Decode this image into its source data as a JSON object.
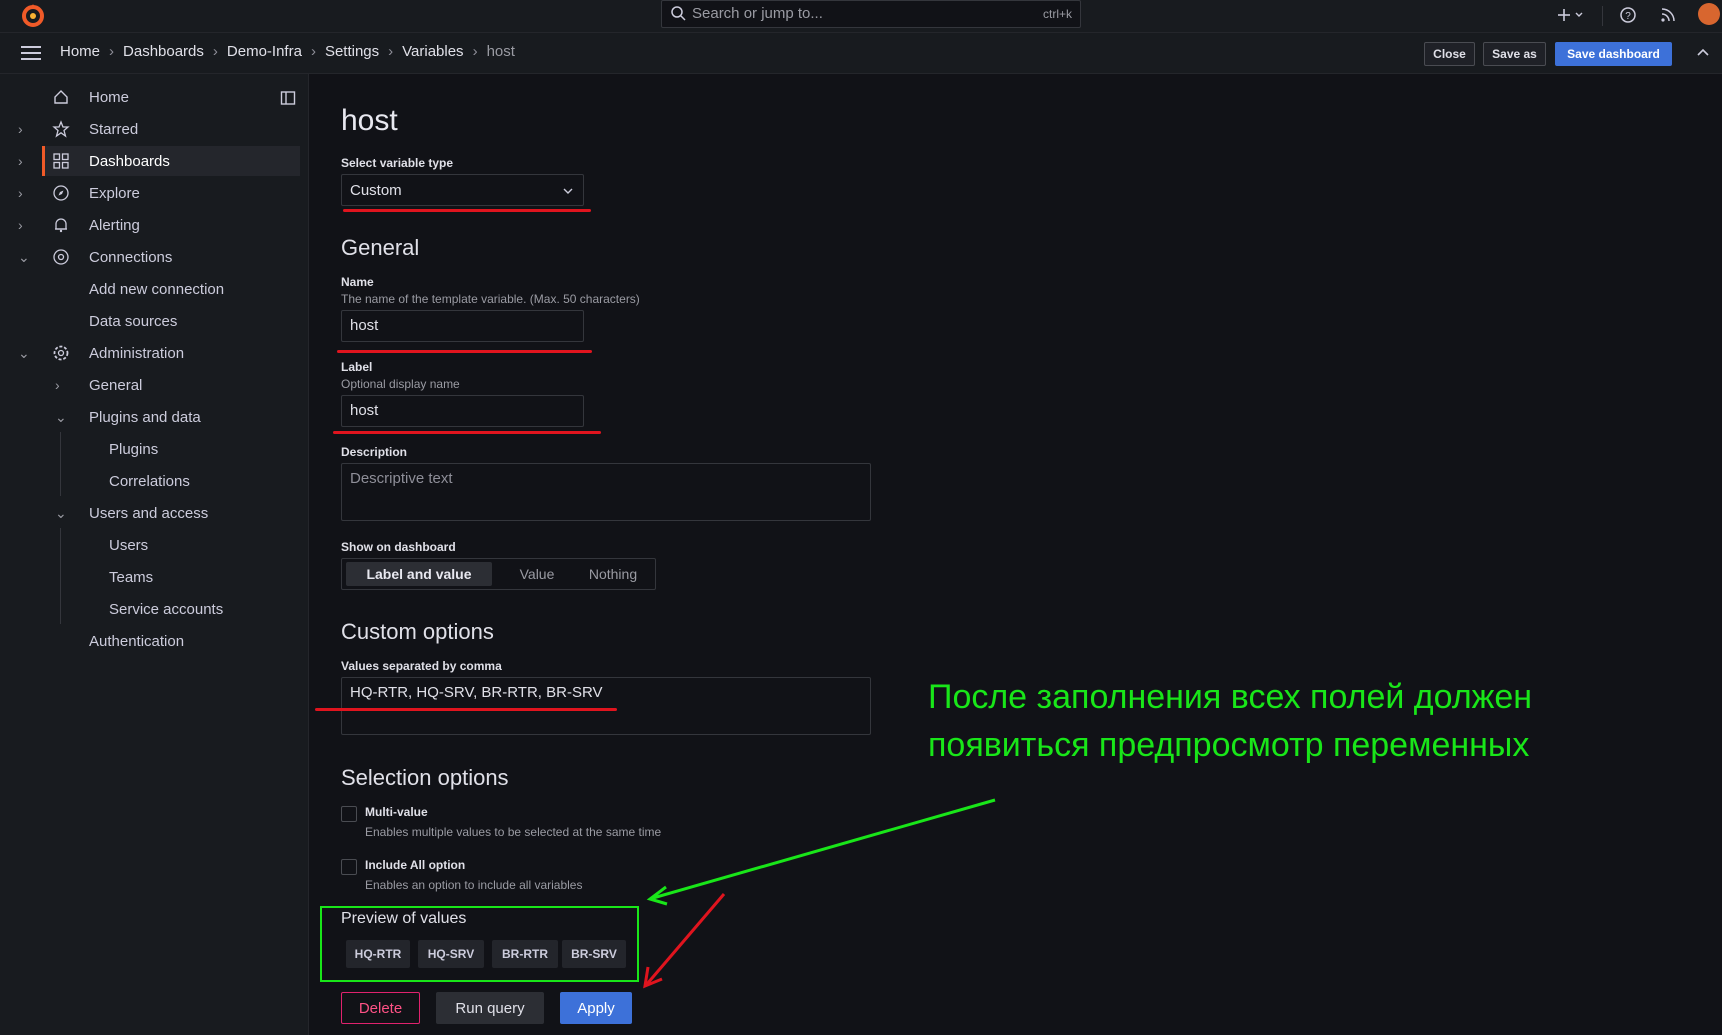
{
  "topbar": {
    "search_placeholder": "Search or jump to...",
    "search_shortcut": "ctrl+k",
    "add_icon": "plus-icon",
    "help_icon": "help-icon",
    "news_icon": "rss-icon"
  },
  "breadcrumb": [
    "Home",
    "Dashboards",
    "Demo-Infra",
    "Settings",
    "Variables",
    "host"
  ],
  "toolbar": {
    "close": "Close",
    "save_as": "Save as",
    "save_dashboard": "Save dashboard"
  },
  "sidebar": {
    "home": "Home",
    "starred": "Starred",
    "dashboards": "Dashboards",
    "explore": "Explore",
    "alerting": "Alerting",
    "connections": "Connections",
    "add_new_connection": "Add new connection",
    "data_sources": "Data sources",
    "administration": "Administration",
    "general": "General",
    "plugins_and_data": "Plugins and data",
    "plugins": "Plugins",
    "correlations": "Correlations",
    "users_and_access": "Users and access",
    "users": "Users",
    "teams": "Teams",
    "service_accounts": "Service accounts",
    "authentication": "Authentication"
  },
  "form": {
    "title": "host",
    "select_type_label": "Select variable type",
    "select_type_value": "Custom",
    "general_heading": "General",
    "name_label": "Name",
    "name_desc": "The name of the template variable. (Max. 50 characters)",
    "name_value": "host",
    "label_label": "Label",
    "label_desc": "Optional display name",
    "label_value": "host",
    "description_label": "Description",
    "description_placeholder": "Descriptive text",
    "show_on_dashboard_label": "Show on dashboard",
    "show_options": [
      "Label and value",
      "Value",
      "Nothing"
    ],
    "custom_options_heading": "Custom options",
    "values_label": "Values separated by comma",
    "values_value": "HQ-RTR, HQ-SRV, BR-RTR, BR-SRV",
    "selection_heading": "Selection options",
    "multi_value_label": "Multi-value",
    "multi_value_desc": "Enables multiple values to be selected at the same time",
    "include_all_label": "Include All option",
    "include_all_desc": "Enables an option to include all variables",
    "preview_heading": "Preview of values",
    "preview_values": [
      "HQ-RTR",
      "HQ-SRV",
      "BR-RTR",
      "BR-SRV"
    ],
    "delete": "Delete",
    "run_query": "Run query",
    "apply": "Apply"
  },
  "annotation": {
    "line1": "После заполнения всех полей должен",
    "line2": "появиться предпросмотр переменных",
    "color": "#19e619"
  },
  "colors": {
    "accent": "#3d71d9",
    "danger": "#e0226e",
    "brand": "#f05a28",
    "underline": "#e0141e"
  }
}
